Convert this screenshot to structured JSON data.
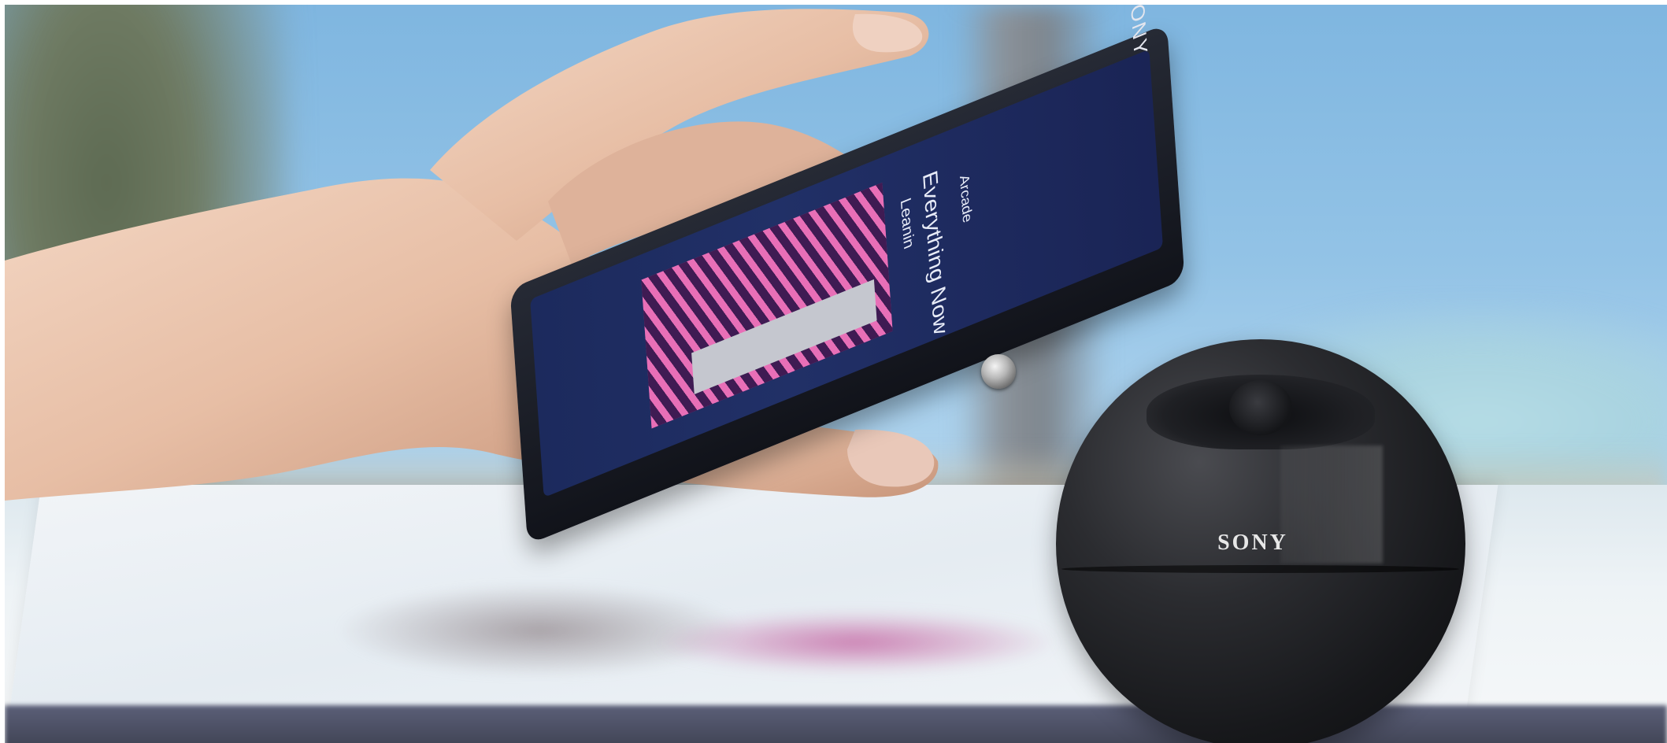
{
  "photo": {
    "speaker_brand_text": "SONY",
    "phone_brand_text": "SONY",
    "colors": {
      "sky": "#8fc0e4",
      "speaker_body": "#1b1c1f",
      "album_pink": "#e86fb7",
      "screen_blue": "#1f2d63"
    }
  },
  "phone_screen": {
    "title": "Everything Now",
    "artist": "Leanin",
    "detail": "Arcade"
  }
}
